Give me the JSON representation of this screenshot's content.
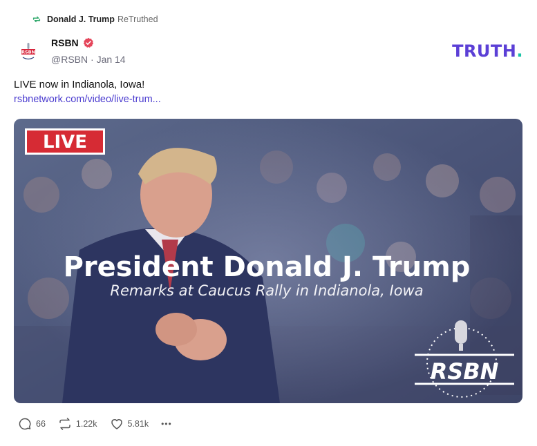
{
  "retruth": {
    "icon": "retruth-icon",
    "user": "Donald J. Trump",
    "action": "ReTruthed"
  },
  "author": {
    "avatar_text": "RSBN",
    "name": "RSBN",
    "verified_icon": "verified-badge-icon",
    "verified_color": "#e5465b",
    "handle": "@RSBN",
    "separator": "·",
    "date": "Jan 14"
  },
  "brand": {
    "logo_text": "TRUTH",
    "logo_dot": ".",
    "color": "#5b3fd6",
    "dot_color": "#18c3a6"
  },
  "post": {
    "text": "LIVE now in Indianola, Iowa!",
    "link": "rsbnetwork.com/video/live-trum..."
  },
  "media": {
    "live_badge": "LIVE",
    "headline": "President Donald J. Trump",
    "subtitle": "Remarks at Caucus Rally in Indianola, Iowa",
    "watermark": "RSBN"
  },
  "actions": {
    "replies": {
      "icon": "reply-icon",
      "count": "66"
    },
    "retruths": {
      "icon": "retruth-icon",
      "count": "1.22k"
    },
    "likes": {
      "icon": "heart-icon",
      "count": "5.81k"
    },
    "more": {
      "icon": "more-icon",
      "label": "•••"
    }
  }
}
